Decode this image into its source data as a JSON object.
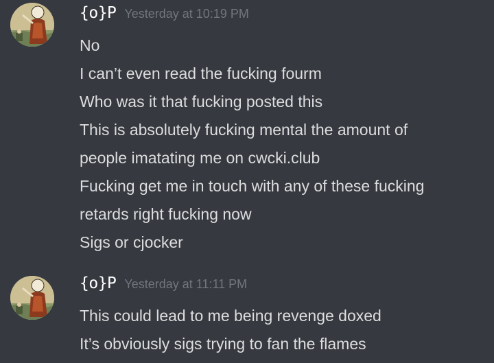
{
  "messages": [
    {
      "avatar_icon": "user-avatar-illustration-icon",
      "username": "{o}P",
      "timestamp": "Yesterday at 10:19 PM",
      "lines": [
        "No",
        "I can’t even read the fucking fourm",
        "Who was it that fucking posted this",
        "This is absolutely fucking mental the amount of",
        "people imatating me on cwcki.club",
        "Fucking get me in touch with any of these fucking",
        "retards right fucking now",
        "Sigs or cjocker"
      ]
    },
    {
      "avatar_icon": "user-avatar-illustration-icon",
      "username": "{o}P",
      "timestamp": "Yesterday at 11:11 PM",
      "lines": [
        "This could lead to me being revenge doxed",
        "It’s obviously sigs trying to fan the flames"
      ]
    }
  ],
  "colors": {
    "background": "#36393f",
    "username": "#ffffff",
    "timestamp": "#72767d",
    "message_text": "#dcddde"
  }
}
